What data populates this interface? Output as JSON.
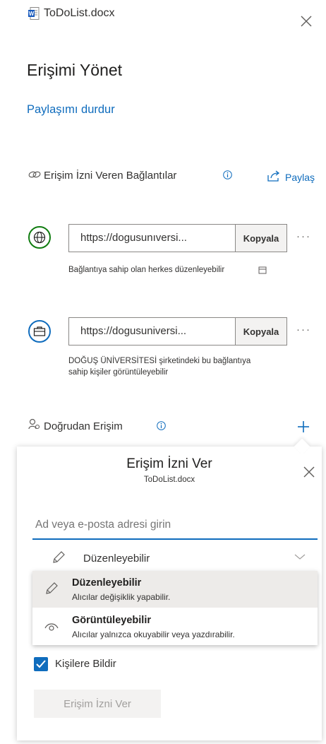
{
  "header": {
    "file_name": "ToDoList.docx",
    "title": "Erişimi Yönet",
    "stop_sharing": "Paylaşımı durdur"
  },
  "links_section": {
    "label": "Erişim İzni Veren Bağlantılar",
    "share_label": "Paylaş"
  },
  "links": [
    {
      "icon": "globe-icon",
      "url": "https://dogusunıversi...",
      "copy_label": "Kopyala",
      "description": "Bağlantıya sahip olan herkes düzenleyebilir",
      "accent": "#107c10"
    },
    {
      "icon": "briefcase-icon",
      "url": "https://dogusuniversi...",
      "copy_label": "Kopyala",
      "description_line1": "DOĞUŞ ÜNİVERSİTESİ şirketindeki bu bağlantıya",
      "description_line2": "sahip kişiler görüntüleyebilir",
      "accent": "#0f6cbd"
    }
  ],
  "direct_access": {
    "label": "Doğrudan Erişim"
  },
  "grant_panel": {
    "title": "Erişim İzni Ver",
    "subtitle": "ToDoList.docx",
    "input_placeholder": "Ad veya e-posta adresi girin",
    "selected_permission": "Düzenleyebilir",
    "options": [
      {
        "title": "Düzenleyebilir",
        "description": "Alıcılar değişiklik yapabilir."
      },
      {
        "title": "Görüntüleyebilir",
        "description": "Alıcılar yalnızca okuyabilir veya yazdırabilir."
      }
    ],
    "notify_label": "Kişilere Bildir",
    "notify_checked": true,
    "grant_button": "Erişim İzni Ver"
  },
  "colors": {
    "accent": "#0f6cbd",
    "globe_green": "#107c10"
  }
}
